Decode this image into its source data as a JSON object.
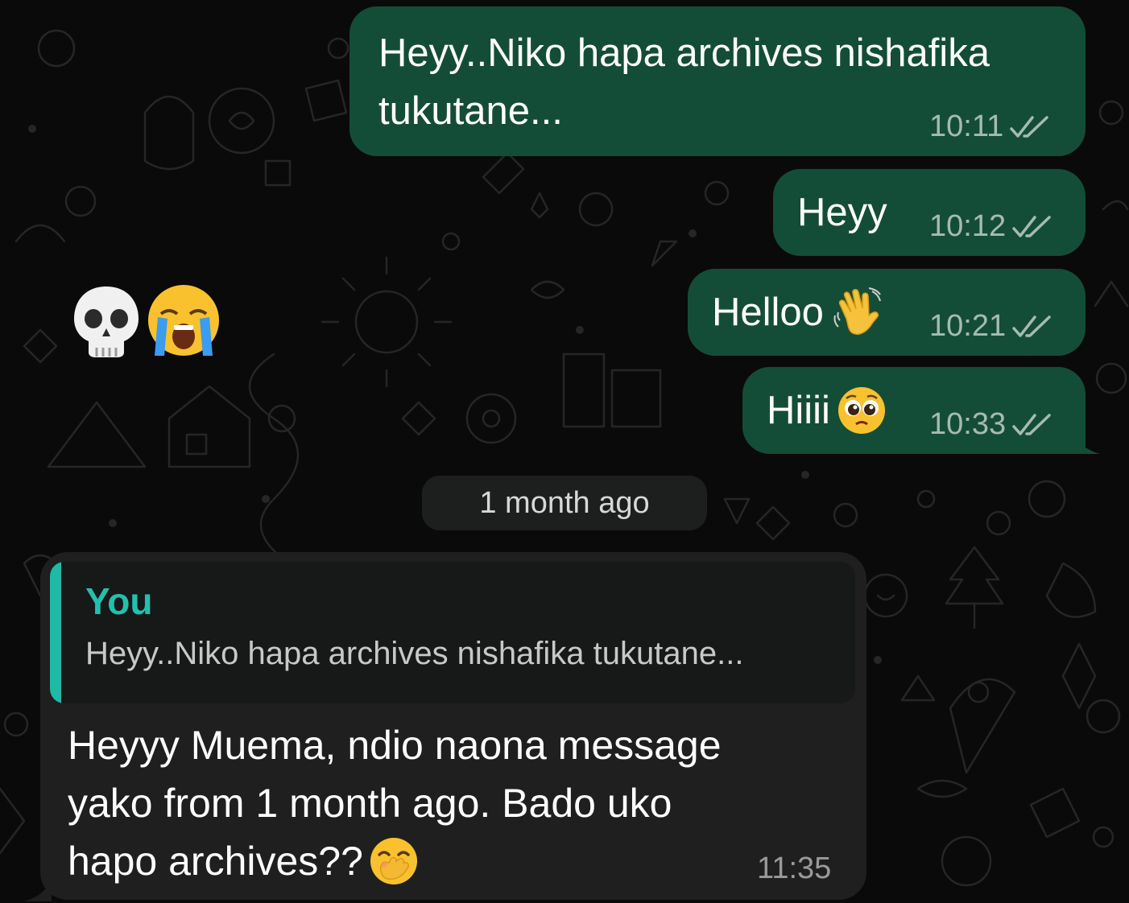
{
  "colors": {
    "outgoing_bubble": "#144d37",
    "incoming_bubble": "#1f1f1f",
    "quote_accent": "#1fb9a6",
    "background": "#0a0a0a"
  },
  "reaction_emojis": [
    "skull",
    "loudly-crying-face"
  ],
  "outgoing_messages": [
    {
      "lines": [
        "Heyy..Niko hapa archives nishafika",
        "tukutane..."
      ],
      "time": "10:11",
      "status": "read"
    },
    {
      "text": "Heyy",
      "time": "10:12",
      "status": "read"
    },
    {
      "text": "Helloo",
      "emoji": "waving-hand",
      "time": "10:21",
      "status": "read"
    },
    {
      "text": "Hiiii",
      "emoji": "pleading-face",
      "time": "10:33",
      "status": "read"
    }
  ],
  "date_separator": "1 month ago",
  "incoming_message": {
    "quote": {
      "author": "You",
      "text": "Heyy..Niko hapa archives nishafika tukutane..."
    },
    "lines": [
      "Heyyy Muema, ndio naona message",
      "yako from 1 month ago. Bado uko",
      "hapo archives??"
    ],
    "emoji": "face-with-hand-over-mouth",
    "time": "11:35"
  }
}
